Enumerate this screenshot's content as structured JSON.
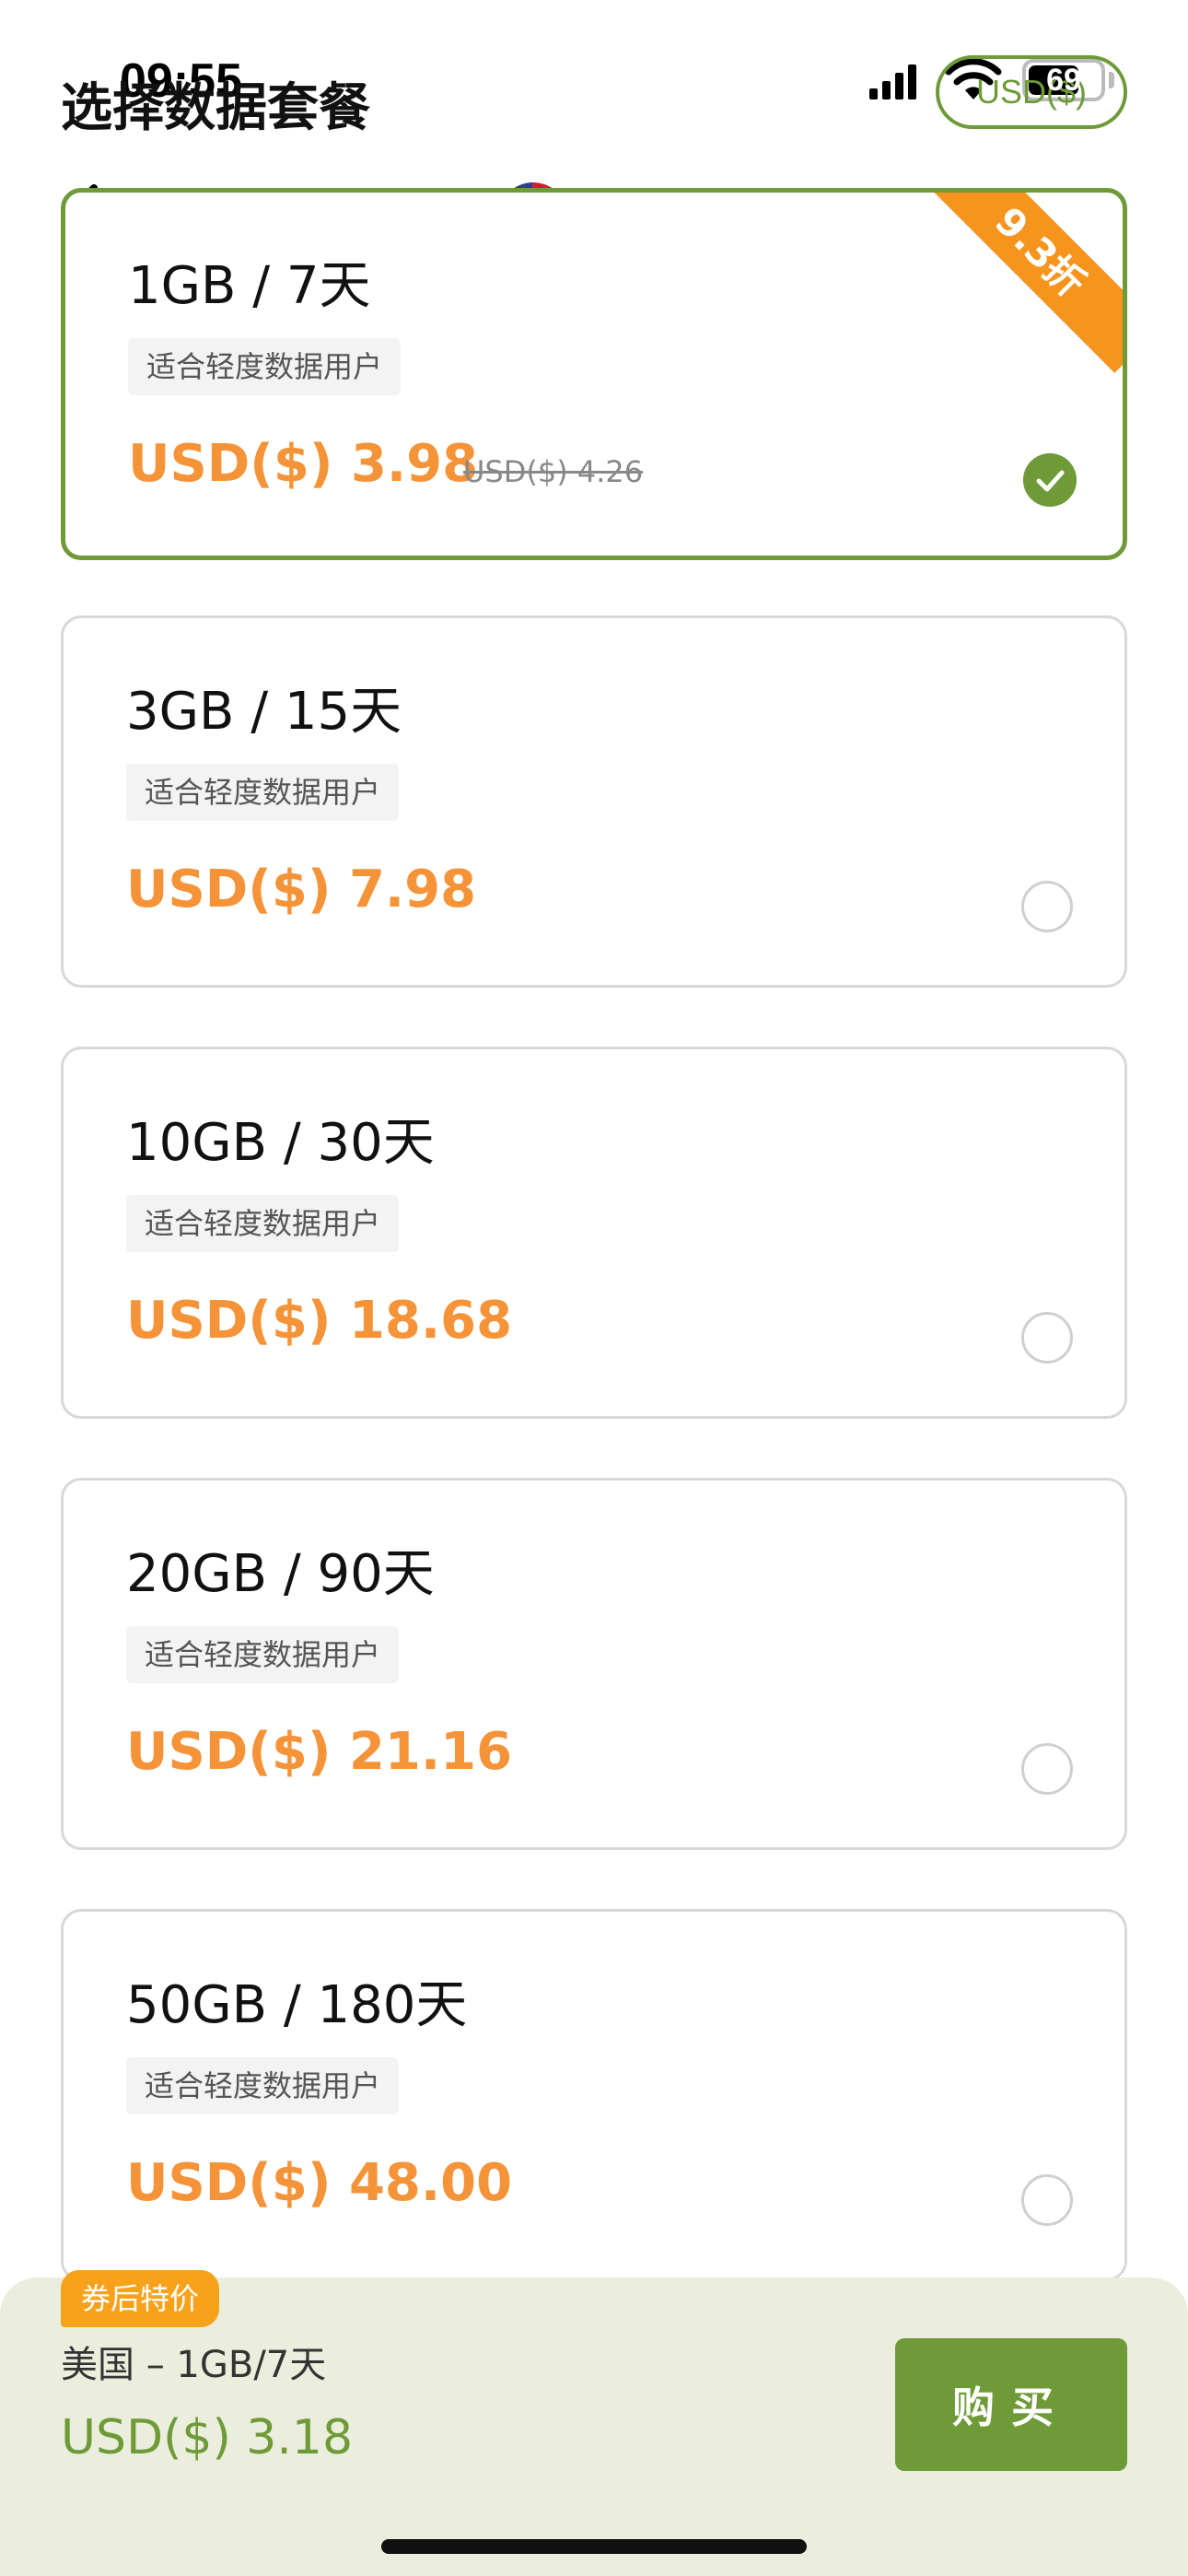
{
  "status_bar": {
    "time": "09:55",
    "battery": "69"
  },
  "header": {
    "title": "选择数据套餐",
    "currency": "USD($)",
    "country": "美国"
  },
  "plans": [
    {
      "title": "1GB / 7天",
      "tag": "适合轻度数据用户",
      "price": "USD($) 3.98",
      "old_price": "USD($) 4.26",
      "discount": "9.3折",
      "selected": true
    },
    {
      "title": "3GB / 15天",
      "tag": "适合轻度数据用户",
      "price": "USD($) 7.98",
      "selected": false
    },
    {
      "title": "10GB / 30天",
      "tag": "适合轻度数据用户",
      "price": "USD($) 18.68",
      "selected": false
    },
    {
      "title": "20GB / 90天",
      "tag": "适合轻度数据用户",
      "price": "USD($) 21.16",
      "selected": false
    },
    {
      "title": "50GB / 180天",
      "tag": "适合轻度数据用户",
      "price": "USD($) 48.00",
      "selected": false
    }
  ],
  "bottom_bar": {
    "coupon_badge": "券后特价",
    "summary": "美国 – 1GB/7天",
    "final_price": "USD($) 3.18",
    "buy_label": "购买"
  },
  "colors": {
    "accent_green": "#6e9a37",
    "price_orange": "#f59338",
    "ribbon_orange": "#f7941d"
  },
  "icons": [
    "signal-icon",
    "wifi-icon",
    "battery-icon",
    "back-chevron-icon",
    "us-flag-icon",
    "checkmark-icon"
  ]
}
